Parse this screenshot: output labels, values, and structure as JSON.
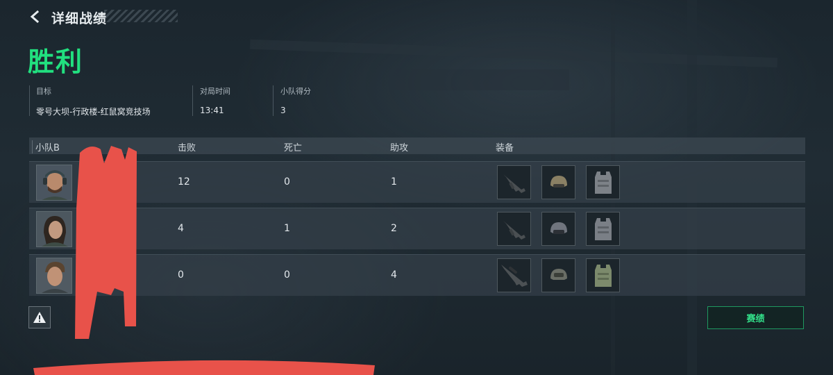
{
  "header": {
    "title": "详细战绩",
    "back_icon": "chevron-left-icon"
  },
  "result": {
    "label": "胜利",
    "color": "#21e07f"
  },
  "info": {
    "target": {
      "label": "目标",
      "value": "零号大坝-行政楼-红鼠窝竞技场"
    },
    "duration": {
      "label": "对局时间",
      "value": "13:41"
    },
    "squad_score": {
      "label": "小队得分",
      "value": "3"
    }
  },
  "table": {
    "headers": {
      "team": "小队B",
      "kills": "击败",
      "deaths": "死亡",
      "assists": "助攻",
      "equipment": "装备"
    },
    "rows": [
      {
        "kills": "12",
        "deaths": "0",
        "assists": "1",
        "equipment": [
          "rifle-icon",
          "helmet-icon",
          "armor-vest-icon"
        ]
      },
      {
        "kills": "4",
        "deaths": "1",
        "assists": "2",
        "equipment": [
          "rifle-icon",
          "helmet-icon",
          "armor-vest-icon"
        ]
      },
      {
        "kills": "0",
        "deaths": "0",
        "assists": "4",
        "equipment": [
          "sniper-rifle-icon",
          "helmet-icon",
          "armor-vest-icon"
        ]
      }
    ]
  },
  "actions": {
    "record_label": "赛绩",
    "report_icon": "warning-icon"
  },
  "colors": {
    "accent": "#21e07f",
    "button_border": "#1f9a60",
    "redaction": "#e8524a"
  }
}
